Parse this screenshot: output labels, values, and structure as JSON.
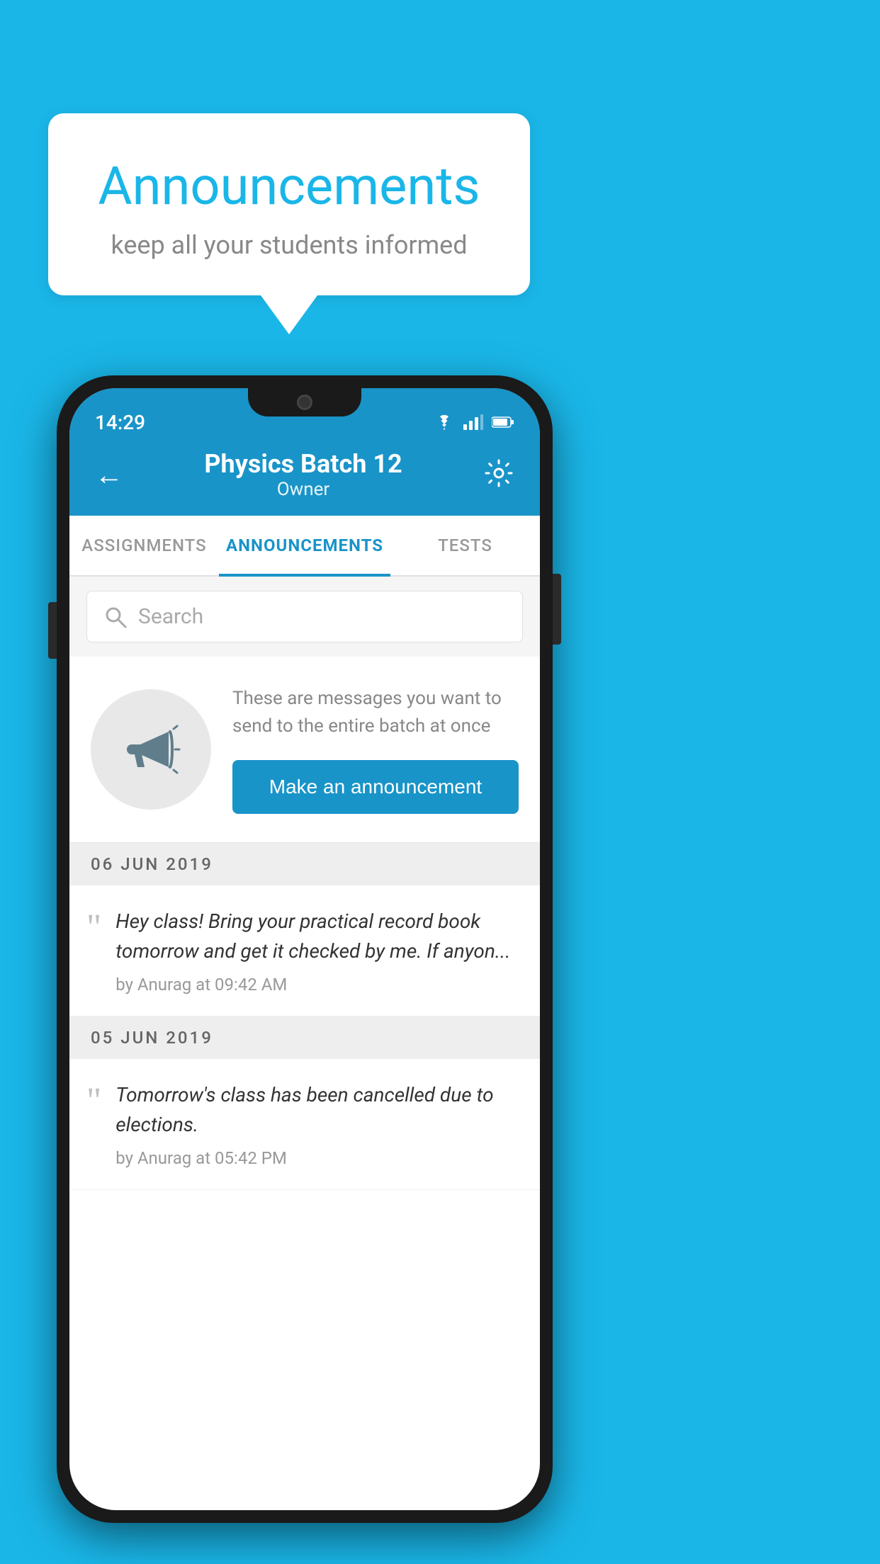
{
  "background_color": "#1ab6e8",
  "speech_bubble": {
    "title": "Announcements",
    "subtitle": "keep all your students informed"
  },
  "phone": {
    "status_bar": {
      "time": "14:29"
    },
    "header": {
      "title": "Physics Batch 12",
      "subtitle": "Owner",
      "back_label": "←"
    },
    "tabs": [
      {
        "label": "ASSIGNMENTS",
        "active": false
      },
      {
        "label": "ANNOUNCEMENTS",
        "active": true
      },
      {
        "label": "TESTS",
        "active": false
      }
    ],
    "search": {
      "placeholder": "Search"
    },
    "announcement_prompt": {
      "description": "These are messages you want to send to the entire batch at once",
      "button_label": "Make an announcement"
    },
    "announcements": [
      {
        "date": "06  JUN  2019",
        "text": "Hey class! Bring your practical record book tomorrow and get it checked by me. If anyon...",
        "meta": "by Anurag at 09:42 AM"
      },
      {
        "date": "05  JUN  2019",
        "text": "Tomorrow's class has been cancelled due to elections.",
        "meta": "by Anurag at 05:42 PM"
      }
    ]
  }
}
